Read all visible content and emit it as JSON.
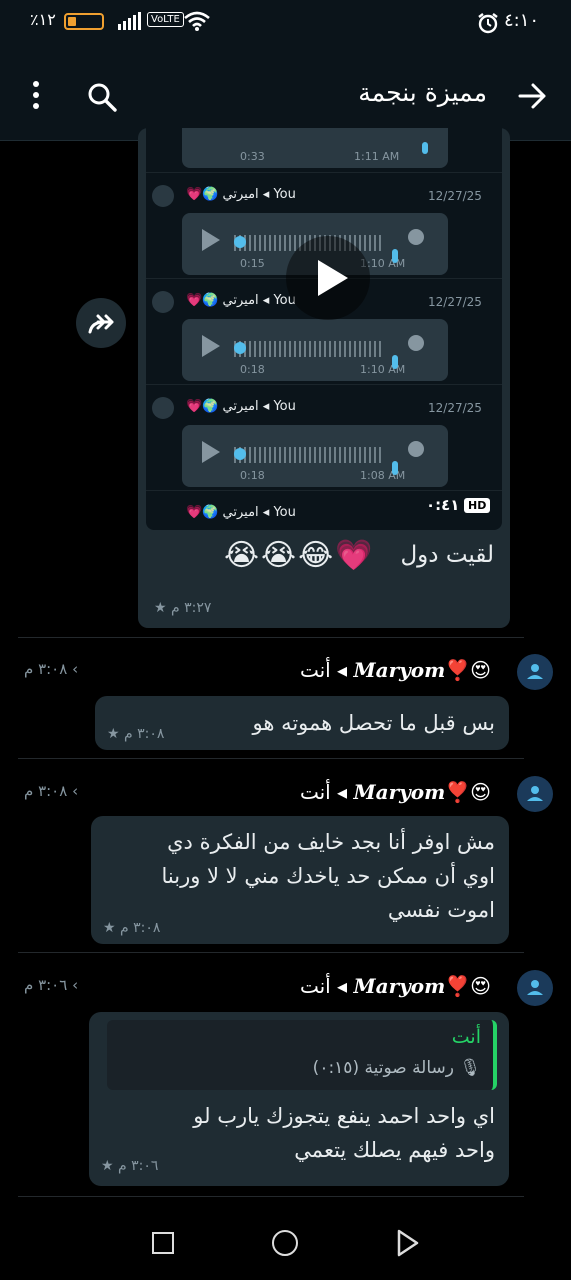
{
  "status_bar": {
    "time": "٤:١٠",
    "battery": "٪١٢",
    "network": "VoLTE"
  },
  "header": {
    "title": "مميزة بنجمة"
  },
  "forwarded": {
    "rows": [
      {
        "user": "You",
        "contact": "اميرتي",
        "date": "12/27/25",
        "duration": "0:15",
        "time": "1:10 AM"
      },
      {
        "user": "You",
        "contact": "اميرتي",
        "date": "12/27/25",
        "duration": "0:18",
        "time": "1:10 AM"
      },
      {
        "user": "You",
        "contact": "اميرتي",
        "date": "12/27/25",
        "duration": "0:18",
        "time": "1:08 AM"
      }
    ],
    "top_partial": {
      "duration": "0:33",
      "time": "1:11 AM"
    },
    "bottom_partial": {
      "user": "You",
      "contact": "اميرتي"
    },
    "video_time": "٠:٤١",
    "hd": "HD",
    "caption": "لقيت دول",
    "emojis": "😭😭😂💗",
    "time": "٣:٢٧ م"
  },
  "messages": [
    {
      "sender": "Maryom",
      "emoji": "😍❣️",
      "you": "أنت",
      "side_time": "٣:٠٨ م",
      "lines": [
        "بس قبل ما تحصل هموته هو"
      ],
      "time": "٣:٠٨ م"
    },
    {
      "sender": "Maryom",
      "emoji": "😍❣️",
      "you": "أنت",
      "side_time": "٣:٠٨ م",
      "lines": [
        "مش اوفر أنا بجد خايف من الفكرة دي",
        "اوي أن ممكن حد ياخدك مني لا لا وربنا",
        "اموت نفسي"
      ],
      "time": "٣:٠٨ م"
    },
    {
      "sender": "Maryom",
      "emoji": "😍❣️",
      "you": "أنت",
      "side_time": "٣:٠٦ م",
      "quote_author": "أنت",
      "quote_text": "رسالة صوتية (٠:١٥)",
      "lines": [
        "اي واحد احمد ينفع يتجوزك يارب لو",
        "واحد فيهم يصلك يتعمي"
      ],
      "time": "٣:٠٦ م"
    }
  ],
  "colors": {
    "bg": "#000000",
    "bar": "#0b141a",
    "bubble": "#1f2c33",
    "accent": "#25d366",
    "voice_dot": "#53bdeb"
  }
}
